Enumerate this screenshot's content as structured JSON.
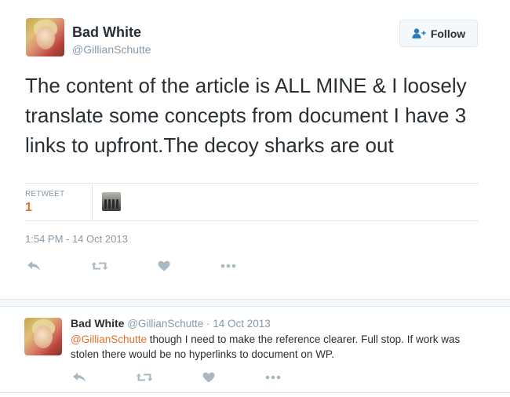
{
  "main_tweet": {
    "display_name": "Bad White",
    "handle": "@GillianSchutte",
    "follow_label": "Follow",
    "text": "The content of the article is ALL MINE & I loosely translate some concepts from document I have 3 links to upfront.The decoy sharks are out",
    "stats": {
      "retweet_label": "RETWEET",
      "retweet_count": "1"
    },
    "timestamp": "1:54 PM - 14 Oct 2013"
  },
  "reply_tweet": {
    "display_name": "Bad White",
    "handle": "@GillianSchutte",
    "separator": " · ",
    "date": "14 Oct 2013",
    "mention": "@GillianSchutte",
    "text": " though I need to make the reference clearer.  Full stop. If work was stolen there would be no hyperlinks to document on WP."
  },
  "icons": {
    "reply": "reply-icon",
    "retweet": "retweet-icon",
    "like": "heart-icon",
    "more": "more-icon",
    "follow": "add-user-icon"
  },
  "colors": {
    "accent": "#e0712d",
    "follow_icon": "#2b7bb9",
    "muted": "#8899a6",
    "text": "#292f33",
    "action_icon": "#aab8c2"
  }
}
